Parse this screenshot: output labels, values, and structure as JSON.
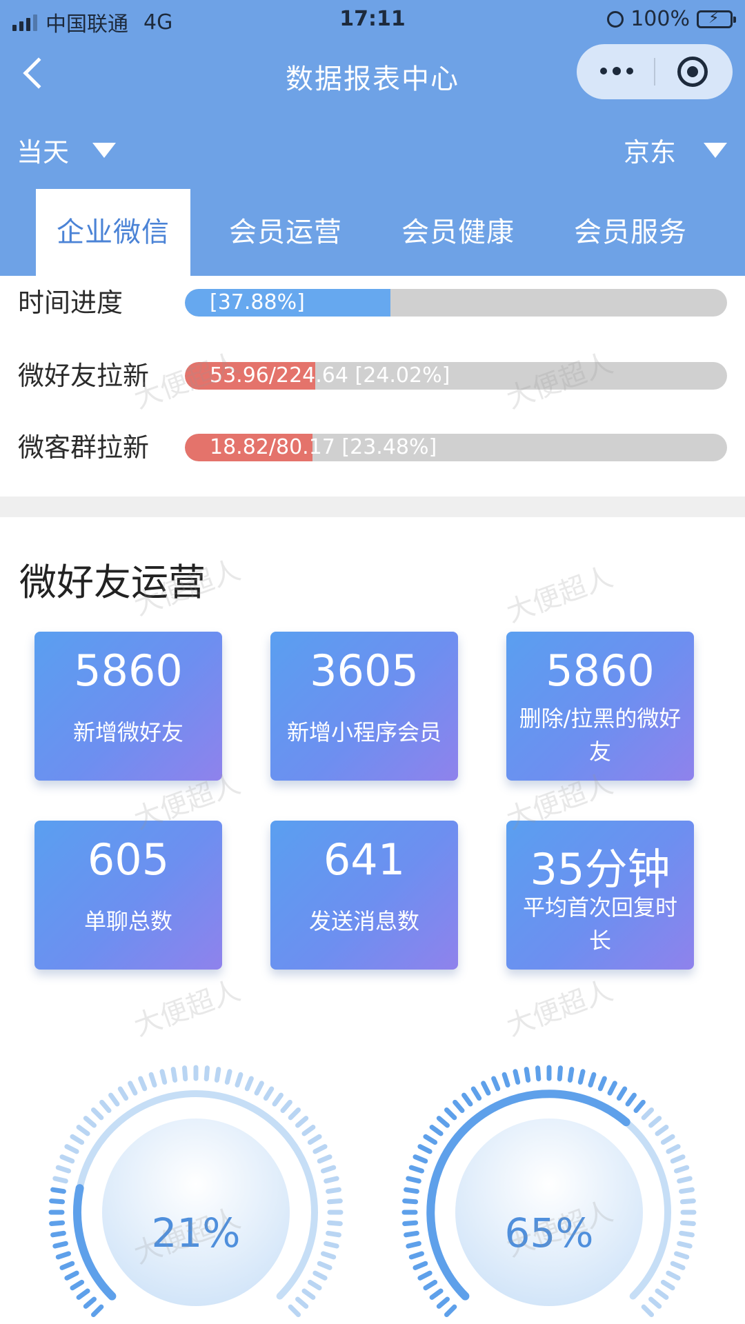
{
  "status_bar": {
    "carrier": "中国联通",
    "network": "4G",
    "time": "17:11",
    "battery": "100%"
  },
  "nav": {
    "title": "数据报表中心"
  },
  "filters": {
    "date": "当天",
    "store": "京东"
  },
  "tabs": [
    {
      "label": "企业微信",
      "active": true
    },
    {
      "label": "会员运营",
      "active": false
    },
    {
      "label": "会员健康",
      "active": false
    },
    {
      "label": "会员服务",
      "active": false
    }
  ],
  "progress": [
    {
      "label": "时间进度",
      "text": "[37.88%]",
      "percent": 37.88,
      "color": "#66a8ef"
    },
    {
      "label": "微好友拉新",
      "text": "53.96/224.64 [24.02%]",
      "percent": 24.02,
      "color": "#e4736b"
    },
    {
      "label": "微客群拉新",
      "text": "18.82/80.17 [23.48%]",
      "percent": 23.48,
      "color": "#e4736b"
    }
  ],
  "friends_section": {
    "title": "微好友运营",
    "cards": [
      {
        "value": "5860",
        "label": "新增微好友"
      },
      {
        "value": "3605",
        "label": "新增小程序会员"
      },
      {
        "value": "5860",
        "label": "删除/拉黑的微好友"
      },
      {
        "value": "605",
        "label": "单聊总数"
      },
      {
        "value": "641",
        "label": "发送消息数"
      },
      {
        "value": "35分钟",
        "label": "平均首次回复时长"
      }
    ]
  },
  "gauges": [
    {
      "text": "21%",
      "percent": 21
    },
    {
      "text": "65%",
      "percent": 65
    }
  ],
  "watermark": "大便超人",
  "colors": {
    "header_bg": "#6ea2e6",
    "accent": "#4b83d6",
    "progress_blue": "#66a8ef",
    "progress_red": "#e4736b"
  }
}
